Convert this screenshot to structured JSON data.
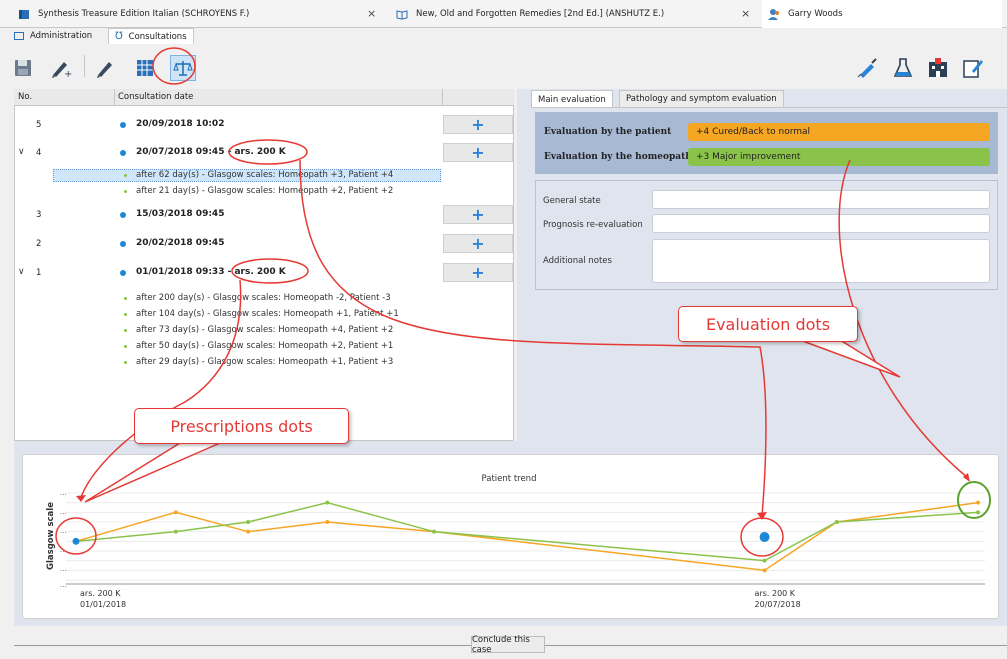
{
  "doc_tabs": [
    {
      "label": "Synthesis Treasure Edition Italian (SCHROYENS F.)"
    },
    {
      "label": "New, Old and Forgotten Remedies [2nd Ed.] (ANSHUTZ E.)"
    },
    {
      "label": "Garry Woods"
    }
  ],
  "close_glyph": "×",
  "sub_tabs": [
    {
      "label": "Administration"
    },
    {
      "label": "Consultations"
    }
  ],
  "toolbar_icons": [
    "save-icon",
    "add-prescription-icon",
    "edit-icon",
    "table-icon",
    "balance-icon",
    "syringe-icon",
    "flask-icon",
    "hospital-icon",
    "notepad-icon"
  ],
  "table": {
    "col_no": "No.",
    "col_date": "Consultation date",
    "rows": [
      {
        "no": "5",
        "date": "20/09/2018 10:02",
        "expanded": false
      },
      {
        "no": "4",
        "date": "20/07/2018 09:45 - ars. 200 K",
        "expanded": true
      },
      {
        "no": "3",
        "date": "15/03/2018 09:45",
        "expanded": false
      },
      {
        "no": "2",
        "date": "20/02/2018 09:45",
        "expanded": false
      },
      {
        "no": "1",
        "date": "01/01/2018 09:33 - ars. 200 K",
        "expanded": true
      }
    ],
    "row4_prescriptions": [
      "after 62 day(s) - Glasgow scales: Homeopath +3, Patient +4",
      "after 21 day(s) - Glasgow scales: Homeopath +2, Patient +2"
    ],
    "row1_prescriptions": [
      "after 200 day(s) - Glasgow scales: Homeopath -2, Patient -3",
      "after 104 day(s) - Glasgow scales: Homeopath +1, Patient +1",
      "after 73 day(s) - Glasgow scales: Homeopath +4, Patient +2",
      "after 50 day(s) - Glasgow scales: Homeopath +2, Patient +1",
      "after 29 day(s) - Glasgow scales: Homeopath +1, Patient +3"
    ],
    "plus_glyph": "+",
    "chevron_glyph": "∨"
  },
  "right": {
    "tabs": [
      "Main evaluation",
      "Pathology and symptom evaluation"
    ],
    "eval_patient_label": "Evaluation by the patient",
    "eval_patient_value": "+4   Cured/Back to normal",
    "eval_homeopath_label": "Evaluation by the homeopath",
    "eval_homeopath_value": "+3   Major improvement",
    "general_state": "General state",
    "prognosis": "Prognosis re-evaluation",
    "notes": "Additional notes",
    "color_patient": "#f5a623",
    "color_homeopath": "#8bc34a"
  },
  "chart_data": {
    "type": "line",
    "title": "Patient trend",
    "ylabel": "Glasgow scale",
    "x_labels": [
      {
        "line1": "ars. 200 K",
        "line2": "01/01/2018"
      },
      {
        "line1": "ars. 200 K",
        "line2": "20/07/2018"
      }
    ],
    "y_tick_glyph": "...",
    "series": [
      {
        "name": "Patient",
        "color": "#f5a623",
        "x": [
          0,
          29,
          50,
          73,
          104,
          200,
          221,
          262
        ],
        "y": [
          0,
          3,
          1,
          2,
          1,
          -3,
          2,
          4
        ]
      },
      {
        "name": "Homeopath",
        "color": "#8bc34a",
        "x": [
          0,
          29,
          50,
          73,
          104,
          200,
          221,
          262
        ],
        "y": [
          0,
          1,
          2,
          4,
          1,
          -2,
          2,
          3
        ]
      }
    ],
    "prescription_points_x": [
      0,
      200
    ]
  },
  "callouts": {
    "prescriptions": "Prescriptions dots",
    "evaluation": "Evaluation dots"
  },
  "conclude": "Conclude this case",
  "colors": {
    "dot_blue": "#1e88d6",
    "annotation_red": "#e53935"
  }
}
